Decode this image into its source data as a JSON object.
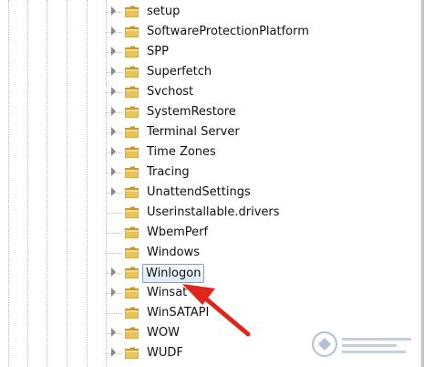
{
  "registry_tree": {
    "items": [
      {
        "label": "setup",
        "expandable": true
      },
      {
        "label": "SoftwareProtectionPlatform",
        "expandable": true
      },
      {
        "label": "SPP",
        "expandable": true
      },
      {
        "label": "Superfetch",
        "expandable": true
      },
      {
        "label": "Svchost",
        "expandable": true
      },
      {
        "label": "SystemRestore",
        "expandable": true
      },
      {
        "label": "Terminal Server",
        "expandable": true
      },
      {
        "label": "Time Zones",
        "expandable": true
      },
      {
        "label": "Tracing",
        "expandable": true
      },
      {
        "label": "UnattendSettings",
        "expandable": true
      },
      {
        "label": "Userinstallable.drivers",
        "expandable": false
      },
      {
        "label": "WbemPerf",
        "expandable": false
      },
      {
        "label": "Windows",
        "expandable": false
      },
      {
        "label": "Winlogon",
        "expandable": true,
        "selected": true
      },
      {
        "label": "Winsat",
        "expandable": true
      },
      {
        "label": "WinSATAPI",
        "expandable": false
      },
      {
        "label": "WOW",
        "expandable": true
      },
      {
        "label": "WUDF",
        "expandable": true
      }
    ]
  },
  "icons": {
    "folder": "folder-icon",
    "expander": "expand-triangle-icon",
    "annotation": "red-arrow-icon",
    "watermark": "site-logo-watermark"
  },
  "colors": {
    "folder_body": "#e8c35a",
    "folder_dark": "#c89a2c",
    "selection_border": "#7da2ce",
    "arrow": "#e0251b"
  }
}
